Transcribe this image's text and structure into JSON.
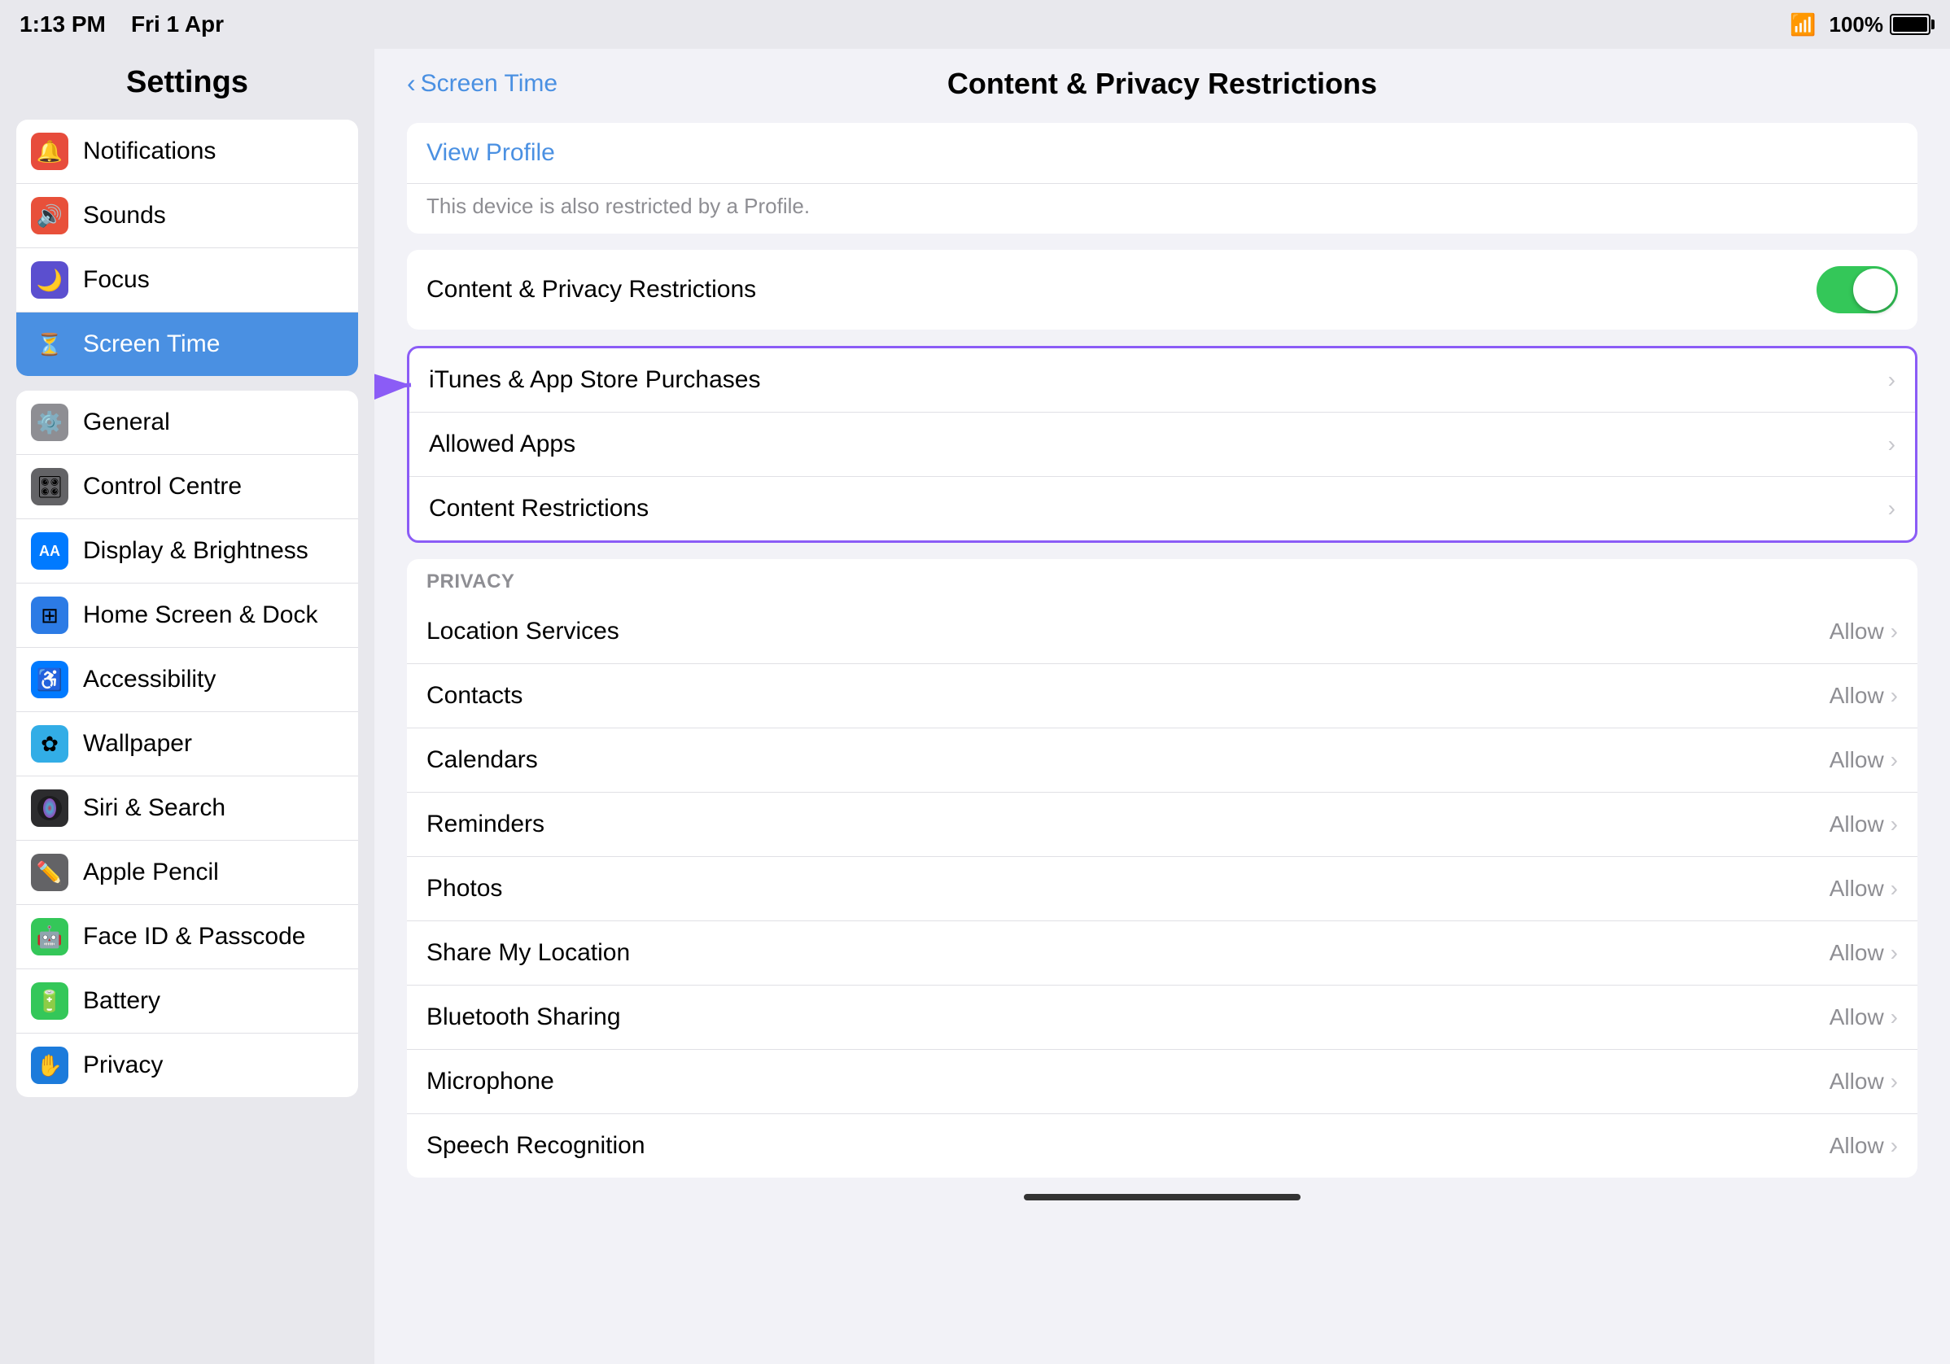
{
  "statusBar": {
    "time": "1:13 PM",
    "date": "Fri 1 Apr",
    "wifi": "WiFi",
    "battery": "100%"
  },
  "sidebar": {
    "title": "Settings",
    "groups": [
      {
        "items": [
          {
            "id": "notifications",
            "label": "Notifications",
            "icon": "🔔",
            "iconColor": "icon-red"
          },
          {
            "id": "sounds",
            "label": "Sounds",
            "icon": "🔊",
            "iconColor": "icon-orange-red"
          },
          {
            "id": "focus",
            "label": "Focus",
            "icon": "🌙",
            "iconColor": "icon-purple"
          },
          {
            "id": "screen-time",
            "label": "Screen Time",
            "icon": "⏳",
            "iconColor": "icon-blue-screen",
            "active": true
          }
        ]
      },
      {
        "items": [
          {
            "id": "general",
            "label": "General",
            "icon": "⚙️",
            "iconColor": "icon-gray"
          },
          {
            "id": "control-centre",
            "label": "Control Centre",
            "icon": "🎛️",
            "iconColor": "icon-dark-gray"
          },
          {
            "id": "display-brightness",
            "label": "Display & Brightness",
            "icon": "AA",
            "iconColor": "icon-blue2",
            "isText": true
          },
          {
            "id": "home-screen",
            "label": "Home Screen & Dock",
            "icon": "⊞",
            "iconColor": "icon-blue2"
          },
          {
            "id": "accessibility",
            "label": "Accessibility",
            "icon": "♿",
            "iconColor": "icon-blue-acc"
          },
          {
            "id": "wallpaper",
            "label": "Wallpaper",
            "icon": "✿",
            "iconColor": "icon-teal"
          },
          {
            "id": "siri-search",
            "label": "Siri & Search",
            "icon": "◎",
            "iconColor": "icon-dark"
          },
          {
            "id": "apple-pencil",
            "label": "Apple Pencil",
            "icon": "✏️",
            "iconColor": "icon-dark2"
          },
          {
            "id": "face-id",
            "label": "Face ID & Passcode",
            "icon": "🤖",
            "iconColor": "icon-green"
          },
          {
            "id": "battery",
            "label": "Battery",
            "icon": "🔋",
            "iconColor": "icon-green"
          },
          {
            "id": "privacy",
            "label": "Privacy",
            "icon": "✋",
            "iconColor": "icon-blue3"
          }
        ]
      }
    ]
  },
  "content": {
    "backLabel": "Screen Time",
    "pageTitle": "Content & Privacy Restrictions",
    "viewProfile": {
      "linkText": "View Profile",
      "description": "This device is also restricted by a Profile."
    },
    "mainToggle": {
      "label": "Content & Privacy Restrictions",
      "enabled": true
    },
    "allowedSection": {
      "items": [
        {
          "id": "itunes",
          "label": "iTunes & App Store Purchases",
          "highlighted": true
        },
        {
          "id": "allowed-apps",
          "label": "Allowed Apps"
        },
        {
          "id": "content-restrictions",
          "label": "Content Restrictions"
        }
      ]
    },
    "privacySection": {
      "header": "PRIVACY",
      "items": [
        {
          "id": "location",
          "label": "Location Services",
          "value": "Allow"
        },
        {
          "id": "contacts",
          "label": "Contacts",
          "value": "Allow"
        },
        {
          "id": "calendars",
          "label": "Calendars",
          "value": "Allow"
        },
        {
          "id": "reminders",
          "label": "Reminders",
          "value": "Allow"
        },
        {
          "id": "photos",
          "label": "Photos",
          "value": "Allow"
        },
        {
          "id": "share-location",
          "label": "Share My Location",
          "value": "Allow"
        },
        {
          "id": "bluetooth",
          "label": "Bluetooth Sharing",
          "value": "Allow"
        },
        {
          "id": "microphone",
          "label": "Microphone",
          "value": "Allow"
        },
        {
          "id": "speech-recognition",
          "label": "Speech Recognition",
          "value": "Allow"
        }
      ]
    }
  }
}
